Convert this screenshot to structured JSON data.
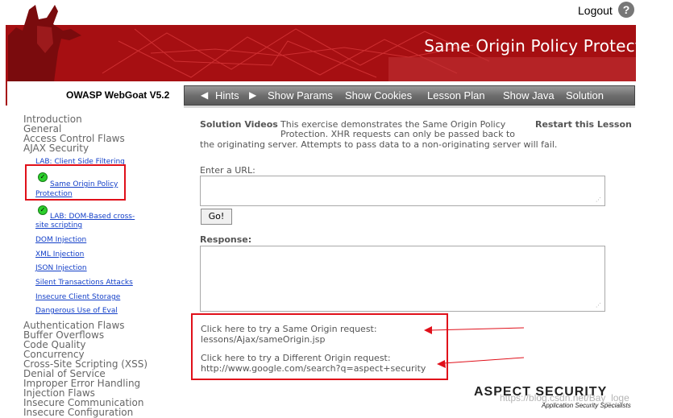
{
  "header": {
    "logout": "Logout",
    "help_icon": "question-mark-icon",
    "banner_title": "Same Origin Policy Protection",
    "brand": "OWASP WebGoat V5.2",
    "colors": {
      "banner": "#a60f12",
      "nav": "#6e6e6e"
    }
  },
  "nav": {
    "prev_icon": "triangle-left-icon",
    "next_icon": "triangle-right-icon",
    "hints": "Hints",
    "show_params": "Show Params",
    "show_cookies": "Show Cookies",
    "lesson_plan": "Lesson Plan",
    "show_java": "Show Java",
    "solution": "Solution"
  },
  "sidebar": {
    "categories_top": [
      "Introduction",
      "General",
      "Access Control Flaws",
      "AJAX Security"
    ],
    "lessons": {
      "client_side_filtering": "LAB: Client Side Filtering",
      "same_origin_1": "Same Origin Policy",
      "same_origin_2": "Protection",
      "dom_xss_1": "LAB: DOM-Based cross-",
      "dom_xss_2": "site scripting",
      "dom_injection": "DOM Injection",
      "xml_injection": "XML Injection",
      "json_injection": "JSON Injection",
      "silent_transactions": "Silent Transactions Attacks",
      "insecure_client_storage": "Insecure Client Storage",
      "dangerous_eval": "Dangerous Use of Eval"
    },
    "categories_bottom": [
      "Authentication Flaws",
      "Buffer Overflows",
      "Code Quality",
      "Concurrency",
      "Cross-Site Scripting (XSS)",
      "Denial of Service",
      "Improper Error Handling",
      "Injection Flaws",
      "Insecure Communication",
      "Insecure Configuration"
    ]
  },
  "content": {
    "solution_videos": "Solution Videos",
    "restart": "Restart this Lesson",
    "description_1": "This exercise demonstrates the Same Origin Policy",
    "description_2": "Protection. XHR requests can only be passed back to",
    "description_3": "the originating server. Attempts to pass data to a non-originating server will fail.",
    "url_label": "Enter a URL:",
    "url_value": "",
    "go_button": "Go!",
    "response_label": "Response:",
    "response_value": "",
    "same_origin_link": "Click here to try a Same Origin request:",
    "same_origin_url": "lessons/Ajax/sameOrigin.jsp",
    "diff_origin_link": "Click here to try a Different Origin request:",
    "diff_origin_url": "http://www.google.com/search?q=aspect+security"
  },
  "footer": {
    "logo": "ASPECT SECURITY",
    "tagline": "Application Security Specialists",
    "watermark": "https://blog.csdn.net/Bay_loge"
  }
}
